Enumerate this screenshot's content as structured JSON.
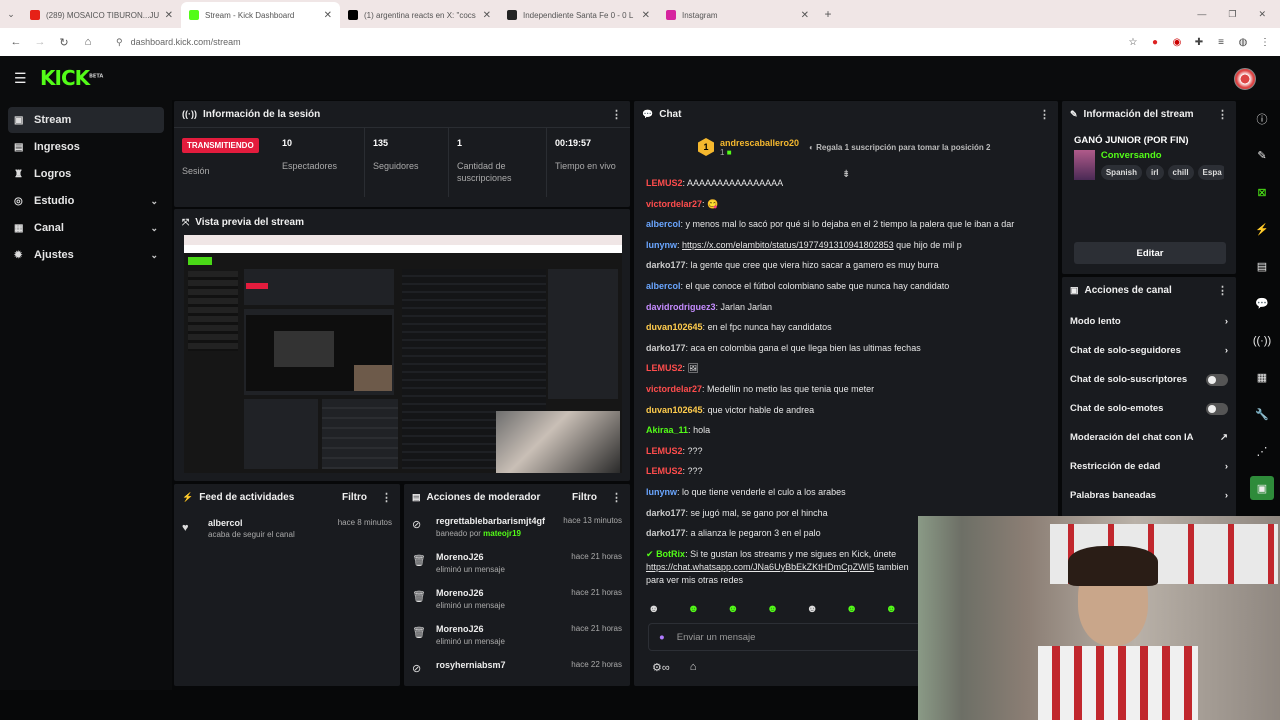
{
  "browser": {
    "tabs": [
      {
        "title": "(289) MOSAICO TIBURON...JU",
        "color": "#e62117"
      },
      {
        "title": "Stream - Kick Dashboard",
        "color": "#53fc18"
      },
      {
        "title": "(1) argentina reacts en X: \"cocs",
        "color": "#000000"
      },
      {
        "title": "Independiente Santa Fe 0 - 0 L",
        "color": "#222222"
      },
      {
        "title": "Instagram",
        "color": "#d6249f"
      }
    ],
    "url": "dashboard.kick.com/stream"
  },
  "logo": {
    "text": "KICK",
    "sup": "BETA"
  },
  "sidebar": {
    "items": [
      {
        "label": "Stream",
        "icon": "stream-icon"
      },
      {
        "label": "Ingresos",
        "icon": "income-icon"
      },
      {
        "label": "Logros",
        "icon": "trophy-icon"
      },
      {
        "label": "Estudio",
        "icon": "studio-icon"
      },
      {
        "label": "Canal",
        "icon": "channel-icon"
      },
      {
        "label": "Ajustes",
        "icon": "gear-icon"
      }
    ]
  },
  "session": {
    "title": "Información de la sesión",
    "status": "TRANSMITIENDO",
    "status_label": "Sesión",
    "stats": [
      {
        "value": "10",
        "label": "Espectadores"
      },
      {
        "value": "135",
        "label": "Seguidores"
      },
      {
        "value": "1",
        "label": "Cantidad de suscripciones"
      },
      {
        "value": "00:19:57",
        "label": "Tiempo en vivo"
      }
    ]
  },
  "preview": {
    "title": "Vista previa del stream"
  },
  "feed": {
    "title": "Feed de actividades",
    "filter": "Filtro",
    "items": [
      {
        "user": "albercol",
        "desc": "acaba de seguir el canal",
        "time": "hace 8 minutos"
      }
    ]
  },
  "mod": {
    "title": "Acciones de moderador",
    "filter": "Filtro",
    "items": [
      {
        "user": "regrettablebarbarismjt4gf",
        "desc": "baneado por",
        "by": "mateojr19",
        "time": "hace 13 minutos"
      },
      {
        "user": "MorenoJ26",
        "desc": "eliminó un mensaje",
        "by": "",
        "time": "hace 21 horas"
      },
      {
        "user": "MorenoJ26",
        "desc": "eliminó un mensaje",
        "by": "",
        "time": "hace 21 horas"
      },
      {
        "user": "MorenoJ26",
        "desc": "eliminó un mensaje",
        "by": "",
        "time": "hace 21 horas"
      },
      {
        "user": "rosyherniabsm7",
        "desc": "",
        "by": "",
        "time": "hace 22 horas"
      }
    ]
  },
  "chat": {
    "title": "Chat",
    "pinned_user": "andrescaballero20",
    "pinned_count": "1",
    "gift_text": "Regala 1 suscripción para tomar la posición 2",
    "input_placeholder": "Enviar un mensaje",
    "messages": [
      {
        "user": "LEMUS2",
        "color": "#ff4d4d",
        "text": "AAAAAAAAAAAAAAAA",
        "link": false
      },
      {
        "user": "victordelar27",
        "color": "#ff4d4d",
        "text": "😋",
        "link": false
      },
      {
        "user": "albercol",
        "color": "#6aa6ff",
        "text": "y menos mal lo sacó por qué si lo dejaba en el 2 tiempo la palera que le iban a dar",
        "link": false
      },
      {
        "user": "lunynw",
        "color": "#6aa6ff",
        "text": "https://x.com/elambito/status/1977491310941802853",
        "suffix": " que hijo de mil p",
        "link": true
      },
      {
        "user": "darko177",
        "color": "#ccc",
        "text": "la gente que cree que viera hizo sacar a gamero es muy burra",
        "link": false
      },
      {
        "user": "albercol",
        "color": "#6aa6ff",
        "text": "el que conoce el fútbol colombiano sabe que nunca hay candidato",
        "link": false
      },
      {
        "user": "davidrodriguez3",
        "color": "#c58cff",
        "text": "Jarlan Jarlan",
        "link": false
      },
      {
        "user": "duvan102645",
        "color": "#ffcc4d",
        "text": "en el fpc nunca hay candidatos",
        "link": false
      },
      {
        "user": "darko177",
        "color": "#ccc",
        "text": "aca en colombia gana el que llega bien las ultimas fechas",
        "link": false
      },
      {
        "user": "LEMUS2",
        "color": "#ff4d4d",
        "text": "🖼",
        "link": false
      },
      {
        "user": "victordelar27",
        "color": "#ff4d4d",
        "text": "Medellin no metio las que tenia que meter",
        "link": false
      },
      {
        "user": "duvan102645",
        "color": "#ffcc4d",
        "text": "que victor hable de andrea",
        "link": false
      },
      {
        "user": "Akiraa_11",
        "color": "#53fc18",
        "text": "hola",
        "link": false
      },
      {
        "user": "LEMUS2",
        "color": "#ff4d4d",
        "text": "???",
        "link": false
      },
      {
        "user": "LEMUS2",
        "color": "#ff4d4d",
        "text": "???",
        "link": false
      },
      {
        "user": "lunynw",
        "color": "#6aa6ff",
        "text": "lo que tiene venderle el culo a los arabes",
        "link": false
      },
      {
        "user": "darko177",
        "color": "#ccc",
        "text": "se jugó mal, se gano por el hincha",
        "link": false
      },
      {
        "user": "darko177",
        "color": "#ccc",
        "text": "a alianza le pegaron 3 en el palo",
        "link": false
      }
    ],
    "bot_user": "BotRix",
    "bot_text": "Si te gustan los streams y me sigues en Kick, únete",
    "bot_link": "https://chat.whatsapp.com/JNa6UyBbEkZKtHDmCpZWI5",
    "bot_suffix": " tambien",
    "bot_line3": "para ver mis otras redes"
  },
  "stream_info": {
    "title": "Información del stream",
    "stream_title": "GANÓ JUNIOR (POR FIN)",
    "category": "Conversando",
    "tags": [
      "Spanish",
      "irl",
      "chill",
      "Espa"
    ],
    "edit": "Editar"
  },
  "channel_actions": {
    "title": "Acciones de canal",
    "items": [
      {
        "label": "Modo lento",
        "control": "chevron"
      },
      {
        "label": "Chat de solo-seguidores",
        "control": "chevron"
      },
      {
        "label": "Chat de solo-suscriptores",
        "control": "toggle"
      },
      {
        "label": "Chat de solo-emotes",
        "control": "toggle"
      },
      {
        "label": "Moderación del chat con IA",
        "control": "external"
      },
      {
        "label": "Restricción de edad",
        "control": "chevron"
      },
      {
        "label": "Palabras baneadas",
        "control": "chevron"
      }
    ]
  }
}
